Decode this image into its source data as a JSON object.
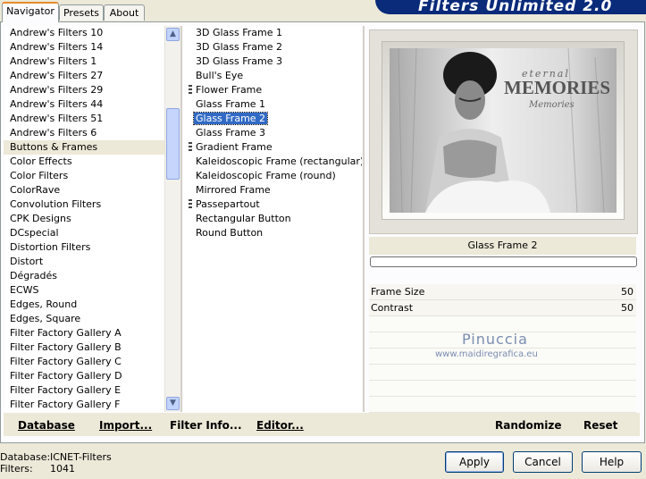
{
  "tabs": {
    "navigator": "Navigator",
    "presets": "Presets",
    "about": "About"
  },
  "banner_title": "Filters Unlimited 2.0",
  "categories": [
    "Andrew's Filters 10",
    "Andrew's Filters 14",
    "Andrew's Filters 1",
    "Andrew's Filters 27",
    "Andrew's Filters 29",
    "Andrew's Filters 44",
    "Andrew's Filters 51",
    "Andrew's Filters 6",
    "Buttons & Frames",
    "Color Effects",
    "Color Filters",
    "ColorRave",
    "Convolution Filters",
    "CPK Designs",
    "DCspecial",
    "Distortion Filters",
    "Distort",
    "Dégradés",
    "ECWS",
    "Edges, Round",
    "Edges, Square",
    "Filter Factory Gallery A",
    "Filter Factory Gallery B",
    "Filter Factory Gallery C",
    "Filter Factory Gallery D",
    "Filter Factory Gallery E",
    "Filter Factory Gallery F"
  ],
  "selected_category": "Buttons & Frames",
  "filters": [
    {
      "label": "3D Glass Frame 1",
      "grip": false
    },
    {
      "label": "3D Glass Frame 2",
      "grip": false
    },
    {
      "label": "3D Glass Frame 3",
      "grip": false
    },
    {
      "label": "Bull's Eye",
      "grip": false
    },
    {
      "label": "Flower Frame",
      "grip": true
    },
    {
      "label": "Glass Frame 1",
      "grip": false
    },
    {
      "label": "Glass Frame 2",
      "grip": false
    },
    {
      "label": "Glass Frame 3",
      "grip": false
    },
    {
      "label": "Gradient Frame",
      "grip": true
    },
    {
      "label": "Kaleidoscopic Frame (rectangular)",
      "grip": false
    },
    {
      "label": "Kaleidoscopic Frame (round)",
      "grip": false
    },
    {
      "label": "Mirrored Frame",
      "grip": false
    },
    {
      "label": "Passepartout",
      "grip": true
    },
    {
      "label": "Rectangular Button",
      "grip": false
    },
    {
      "label": "Round Button",
      "grip": false
    }
  ],
  "selected_filter": "Glass Frame 2",
  "preview": {
    "line1": "eternal",
    "line2": "MEMORIES",
    "line3": "Memories"
  },
  "filter_name_display": "Glass Frame 2",
  "params": [
    {
      "name": "Frame Size",
      "value": "50"
    },
    {
      "name": "Contrast",
      "value": "50"
    }
  ],
  "watermark": {
    "name": "Pinuccia",
    "url": "www.maidiregrafica.eu"
  },
  "toolbar": {
    "database": "Database",
    "import": "Import...",
    "filter_info": "Filter Info...",
    "editor": "Editor...",
    "randomize": "Randomize",
    "reset": "Reset"
  },
  "status": {
    "database_label": "Database:",
    "database_value": "ICNET-Filters",
    "filters_label": "Filters:",
    "filters_value": "1041"
  },
  "buttons": {
    "apply": "Apply",
    "cancel": "Cancel",
    "help": "Help"
  },
  "colors": {
    "selection": "#316ac5",
    "banner": "#0a2a7a",
    "tab_accent": "#e68b2c"
  }
}
